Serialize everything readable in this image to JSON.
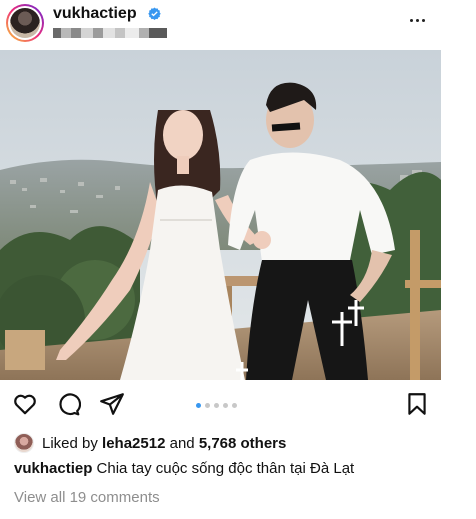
{
  "post": {
    "username": "vukhactiep",
    "verified": true,
    "subtitle_visible": "blurred"
  },
  "photo": {
    "alt_subject": "couple-photo",
    "carousel_total": 5,
    "carousel_active": 1
  },
  "actions": {
    "like_icon": "heart-icon",
    "comment_icon": "comment-bubble-icon",
    "share_icon": "paper-plane-icon",
    "save_icon": "bookmark-icon"
  },
  "likes": {
    "prefix": "Liked by",
    "user": "leha2512",
    "joiner": "and",
    "count": "5,768 others"
  },
  "caption": {
    "username": "vukhactiep",
    "text": "Chia tay cuộc sống độc thân tại Đà Lạt"
  },
  "comments": {
    "label": "View all 19 comments"
  },
  "colors": {
    "verified": "#3897f0",
    "carousel_active": "#3897f0",
    "muted_text": "#8e8e8e"
  }
}
